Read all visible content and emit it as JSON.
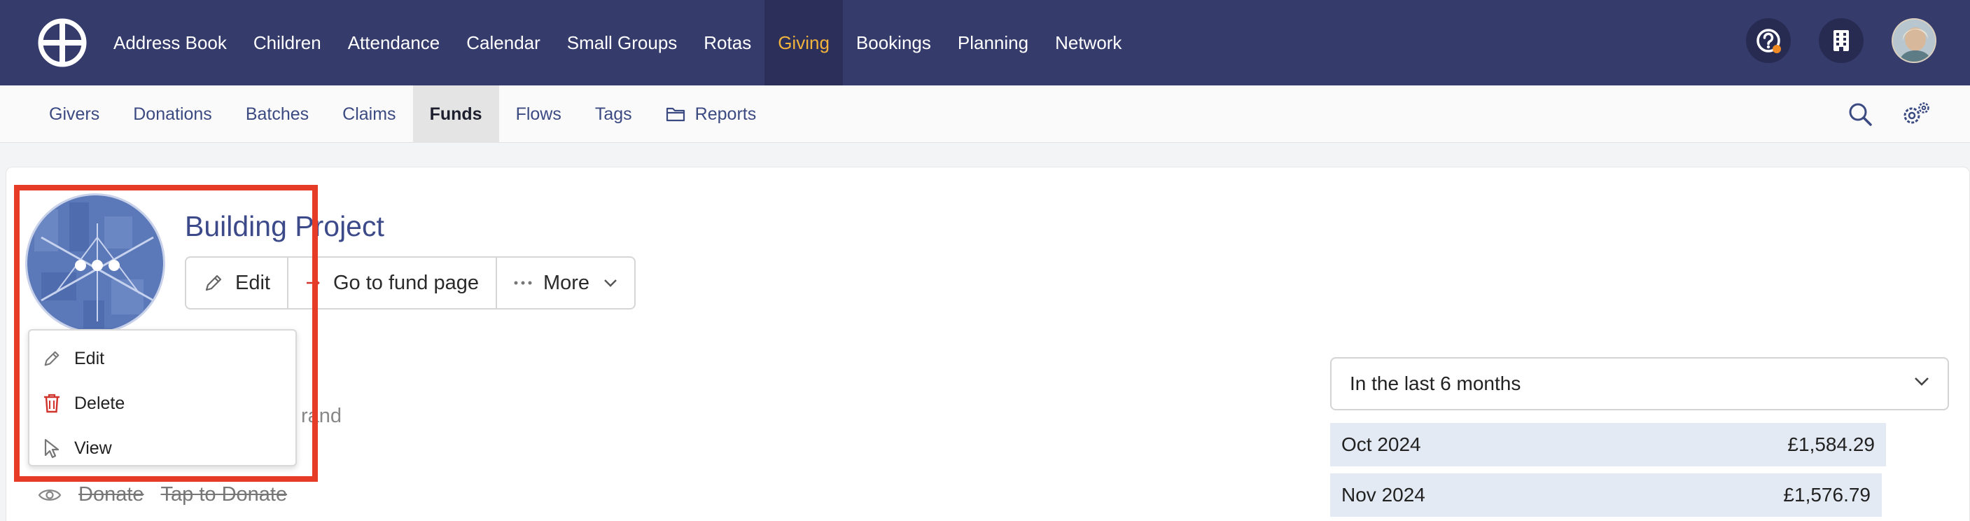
{
  "top_nav": {
    "items": [
      {
        "label": "Address Book"
      },
      {
        "label": "Children"
      },
      {
        "label": "Attendance"
      },
      {
        "label": "Calendar"
      },
      {
        "label": "Small Groups"
      },
      {
        "label": "Rotas"
      },
      {
        "label": "Giving",
        "active": true
      },
      {
        "label": "Bookings"
      },
      {
        "label": "Planning"
      },
      {
        "label": "Network"
      }
    ],
    "icons": [
      "help-icon",
      "building-icon",
      "avatar"
    ]
  },
  "sub_nav": {
    "items": [
      {
        "label": "Givers"
      },
      {
        "label": "Donations"
      },
      {
        "label": "Batches"
      },
      {
        "label": "Claims"
      },
      {
        "label": "Funds",
        "active": true
      },
      {
        "label": "Flows"
      },
      {
        "label": "Tags"
      },
      {
        "label": "Reports",
        "icon": "folder-icon"
      }
    ],
    "icons": [
      "search-icon",
      "settings-icon"
    ]
  },
  "fund": {
    "title": "Building Project",
    "actions": {
      "edit": "Edit",
      "go_to_page": "Go to fund page",
      "more": "More"
    }
  },
  "image_menu": {
    "options": [
      {
        "label": "Edit",
        "icon": "pencil-icon"
      },
      {
        "label": "Delete",
        "icon": "trash-icon"
      },
      {
        "label": "View",
        "icon": "pointer-icon"
      }
    ]
  },
  "partial_text": "rand",
  "donate_row": {
    "donate": "Donate",
    "tap": "Tap to Donate"
  },
  "stats": {
    "period": "In the last 6 months",
    "months": [
      {
        "month": "Oct 2024",
        "amount": "£1,584.29"
      },
      {
        "month": "Nov 2024",
        "amount": "£1,576.79"
      }
    ]
  },
  "colors": {
    "topbar": "#353b6b",
    "accent": "#f2b33d",
    "link": "#3c4a82",
    "highlight": "#e53b27",
    "delete_icon": "#d0342c"
  }
}
